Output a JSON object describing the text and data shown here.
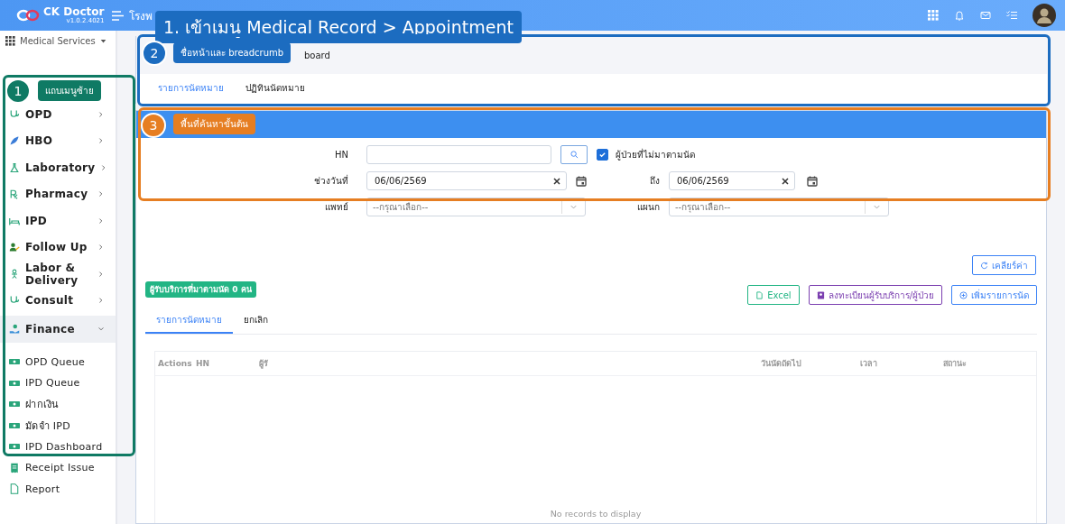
{
  "header": {
    "app_name": "CK Doctor",
    "version": "v1.0.2.4021",
    "hospital_name": "โรงพ"
  },
  "module_menu": {
    "label": "Medical Services"
  },
  "sidebar": {
    "items": [
      {
        "kind": "group",
        "label": "OPD",
        "expanded": false,
        "selected": false
      },
      {
        "kind": "group",
        "label": "HBO",
        "expanded": false,
        "selected": false
      },
      {
        "kind": "group",
        "label": "Laboratory",
        "expanded": false,
        "selected": false
      },
      {
        "kind": "group",
        "label": "Pharmacy",
        "expanded": false,
        "selected": false
      },
      {
        "kind": "group",
        "label": "IPD",
        "expanded": false,
        "selected": false
      },
      {
        "kind": "group",
        "label": "Follow Up",
        "expanded": false,
        "selected": false
      },
      {
        "kind": "group",
        "label": "Labor & Delivery",
        "expanded": false,
        "selected": false
      },
      {
        "kind": "group",
        "label": "Consult",
        "expanded": false,
        "selected": false
      },
      {
        "kind": "group",
        "label": "Finance",
        "expanded": true,
        "selected": true,
        "children": [
          {
            "label": "OPD Queue"
          },
          {
            "label": "IPD Queue"
          },
          {
            "label": "ฝากเงิน"
          },
          {
            "label": "มัดจำ IPD"
          },
          {
            "label": "IPD Dashboard"
          }
        ]
      },
      {
        "kind": "link",
        "label": "Receipt Issue",
        "selected": false
      },
      {
        "kind": "link",
        "label": "Report",
        "selected": false
      }
    ]
  },
  "page": {
    "breadcrumb": "board",
    "tabs": [
      {
        "label": "รายการนัดหมาย",
        "selected": true
      },
      {
        "label": "ปฏิทินนัดหมาย",
        "selected": false
      }
    ]
  },
  "search": {
    "hn": {
      "label": "HN"
    },
    "missed_checkbox": {
      "label": "ผู้ป่วยที่ไม่มาตามนัด",
      "checked": true
    },
    "date_from": {
      "label": "ช่วงวันที่",
      "value": "06/06/2569"
    },
    "date_to": {
      "label": "ถึง",
      "value": "06/06/2569"
    },
    "doctor": {
      "label": "แพทย์",
      "placeholder": "--กรุณาเลือก--"
    },
    "department": {
      "label": "แผนก",
      "placeholder": "--กรุณาเลือก--"
    },
    "clear_button": "เคลียร์ค่า"
  },
  "results": {
    "badge": "ผู้รับบริการที่มาตามนัด 0 คน",
    "buttons": [
      {
        "kind": "excel",
        "label": "Excel"
      },
      {
        "kind": "register",
        "label": "ลงทะเบียนผู้รับบริการ/ผู้ป่วย"
      },
      {
        "kind": "add",
        "label": "เพิ่มรายการนัด"
      }
    ],
    "tabs": [
      {
        "label": "รายการนัดหมาย",
        "selected": true
      },
      {
        "label": "ยกเลิก",
        "selected": false
      }
    ],
    "table": {
      "columns": [
        "Actions",
        "HN",
        "ผู้รั",
        "วันนัดถัดไป",
        "เวลา",
        "สถานะ"
      ],
      "empty_message": "No records to display"
    }
  },
  "annotations": {
    "title": "1. เข้าเมนู Medical Record > Appointment",
    "markers": [
      {
        "number": "1",
        "label": "แถบเมนูซ้าย",
        "color": "#0f7a64"
      },
      {
        "number": "2",
        "label": "ชื่อหน้าและ breadcrumb",
        "color": "#1c6cc0"
      },
      {
        "number": "3",
        "label": "พื้นที่ค้นหาขั้นต้น",
        "color": "#e67e22"
      }
    ]
  }
}
